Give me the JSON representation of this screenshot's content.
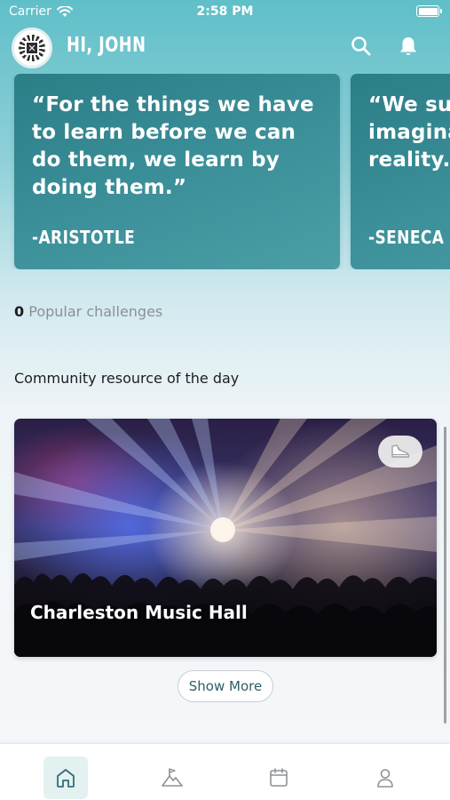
{
  "status_bar": {
    "carrier": "Carrier",
    "time": "2:58 PM"
  },
  "header": {
    "greeting": "HI, JOHN"
  },
  "quotes": [
    {
      "text": "“For the things we have to learn before we can do them, we learn by doing them.”",
      "author": "-ARISTOTLE"
    },
    {
      "text": "“We suf imagina reality.”",
      "author": "-SENECA"
    }
  ],
  "popular": {
    "count": "0",
    "label": "Popular challenges"
  },
  "community": {
    "section_title": "Community resource of the day",
    "resource_name": "Charleston Music Hall",
    "show_more_label": "Show More"
  },
  "tabs": [
    "home-icon",
    "challenges-icon",
    "calendar-icon",
    "profile-icon"
  ],
  "colors": {
    "accent": "#3b8f98",
    "tab_active_bg": "#e3f1f1",
    "text_muted": "#8b9094"
  }
}
